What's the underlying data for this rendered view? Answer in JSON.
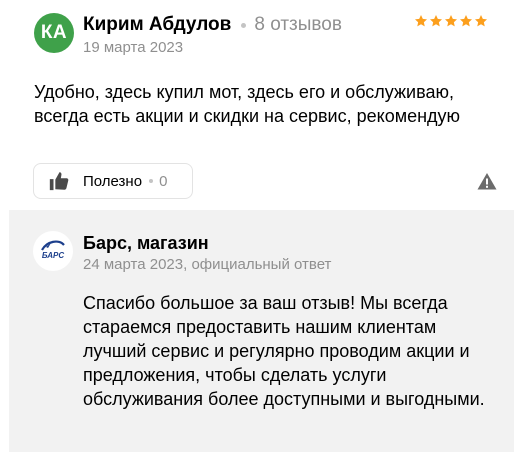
{
  "review": {
    "avatar_initials": "КА",
    "avatar_color": "#3fa14a",
    "author": "Кирим Абдулов",
    "review_count": "8 отзывов",
    "date": "19 марта 2023",
    "rating": 5,
    "star_color": "#fc9f1d",
    "text": "Удобно, здесь купил мот, здесь его и обслуживаю, всегда есть акции и скидки на сервис, рекомендую"
  },
  "actions": {
    "useful_label": "Полезно",
    "useful_count": "0",
    "thumbs_icon": "thumbs-up-icon",
    "report_icon": "warning-triangle-icon"
  },
  "reply": {
    "business_name": "Барс, магазин",
    "logo_text": "БАРС",
    "date": "24 марта 2023",
    "badge": "официальный ответ",
    "text": "Спасибо большое за ваш отзыв! Мы всегда стараемся предоставить нашим клиентам лучший сервис и регулярно проводим акции и предложения, чтобы сделать услуги обслуживания более доступными и выгодными."
  }
}
